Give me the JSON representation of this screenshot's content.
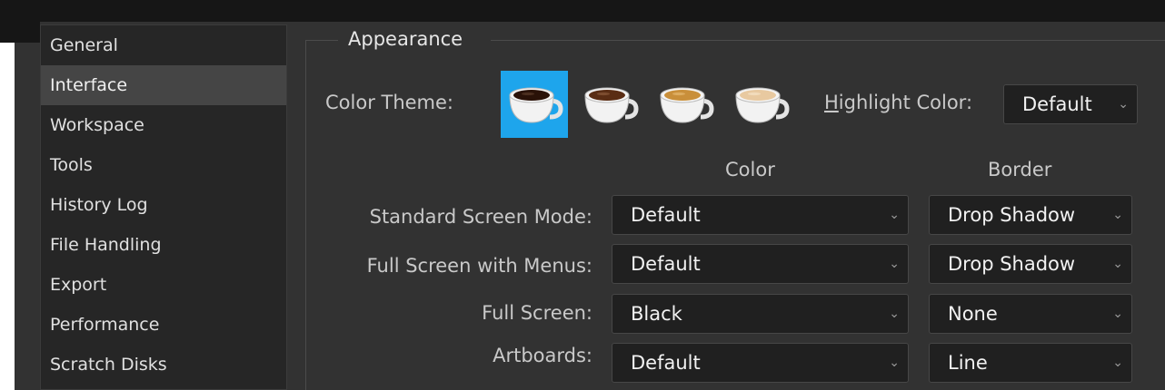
{
  "sidebar": {
    "items": [
      {
        "label": "General"
      },
      {
        "label": "Interface"
      },
      {
        "label": "Workspace"
      },
      {
        "label": "Tools"
      },
      {
        "label": "History Log"
      },
      {
        "label": "File Handling"
      },
      {
        "label": "Export"
      },
      {
        "label": "Performance"
      },
      {
        "label": "Scratch Disks"
      }
    ],
    "active_index": 1
  },
  "appearance": {
    "title": "Appearance",
    "color_theme_label": "Color Theme:",
    "themes": [
      {
        "icon": "coffee-cup-darkest-icon",
        "liquid": "#2a1208",
        "selected": true
      },
      {
        "icon": "coffee-cup-dark-icon",
        "liquid": "#5a2d14",
        "selected": false
      },
      {
        "icon": "coffee-cup-medium-icon",
        "liquid": "#c98f3a",
        "selected": false
      },
      {
        "icon": "coffee-cup-light-icon",
        "liquid": "#e8c9a0",
        "selected": false
      }
    ],
    "highlight_label_accel": "H",
    "highlight_label_rest": "ighlight Color:",
    "highlight_value": "Default",
    "color_header": "Color",
    "border_header": "Border",
    "rows": [
      {
        "label": "Standard Screen Mode:",
        "color": "Default",
        "border": "Drop Shadow"
      },
      {
        "label": "Full Screen with Menus:",
        "color": "Default",
        "border": "Drop Shadow"
      },
      {
        "label": "Full Screen:",
        "color": "Black",
        "border": "None"
      },
      {
        "label": "Artboards:",
        "color": "Default",
        "border": "Line"
      }
    ]
  },
  "colors": {
    "accent": "#1ea5ec",
    "panel_bg": "#323232",
    "sidebar_bg": "#262626",
    "field_bg": "#202020"
  }
}
